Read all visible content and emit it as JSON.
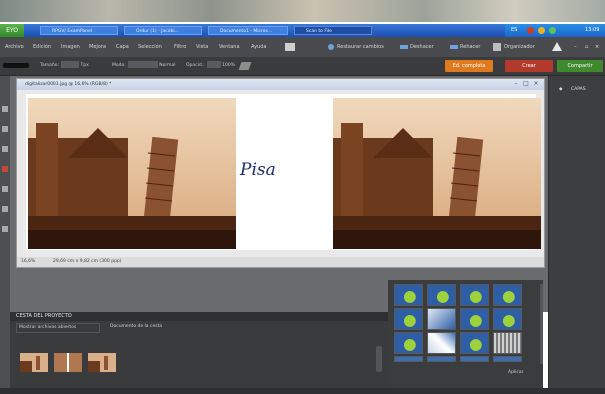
{
  "taskbar": {
    "start_label": "EYO",
    "buttons": [
      {
        "label": "RPGV/ ExamPanel",
        "active": false
      },
      {
        "label": "Ordur (1) - Jacobi...",
        "active": false
      },
      {
        "label": "Documento1 - Micros...",
        "active": false
      },
      {
        "label": "Scan to File",
        "active": true
      }
    ],
    "tray": {
      "lang": "ES",
      "clock": "13:09"
    }
  },
  "menubar": {
    "items": [
      "Archivo",
      "Edición",
      "Imagen",
      "Mejora",
      "Capa",
      "Selección",
      "Filtro",
      "Vista",
      "Ventana",
      "Ayuda"
    ],
    "actions": [
      "Restaurar cambios",
      "Deshacer",
      "Rehacer",
      "Organizador"
    ]
  },
  "options": {
    "tamano_label": "Tamaño:",
    "tamano_value": "Tpx",
    "modo_label": "Modo:",
    "modo_value": "Normal",
    "opac_label": "Opacid.:",
    "opac_value": "100%"
  },
  "modes": {
    "full": "Ed. completa",
    "quick": "Crear",
    "share": "Compartir"
  },
  "colors": {
    "full": "#e07a1f",
    "quick": "#b33a2a",
    "share": "#3e8a2d"
  },
  "document": {
    "title": "digitalizar0001.jpg @ 16,6% (RGB/8) *",
    "handwritten": "Pisa",
    "zoom": "16,6%",
    "status": "29,69 cm x 9,82 cm (300 ppp)"
  },
  "panel": {
    "header": "CAPAS"
  },
  "project_bin": {
    "title": "CESTA DEL PROYECTO",
    "show_label": "Mostrar archivos abiertos",
    "bin_label": "Documento de la cesta"
  },
  "effects": {
    "footer": "Aplicar"
  }
}
